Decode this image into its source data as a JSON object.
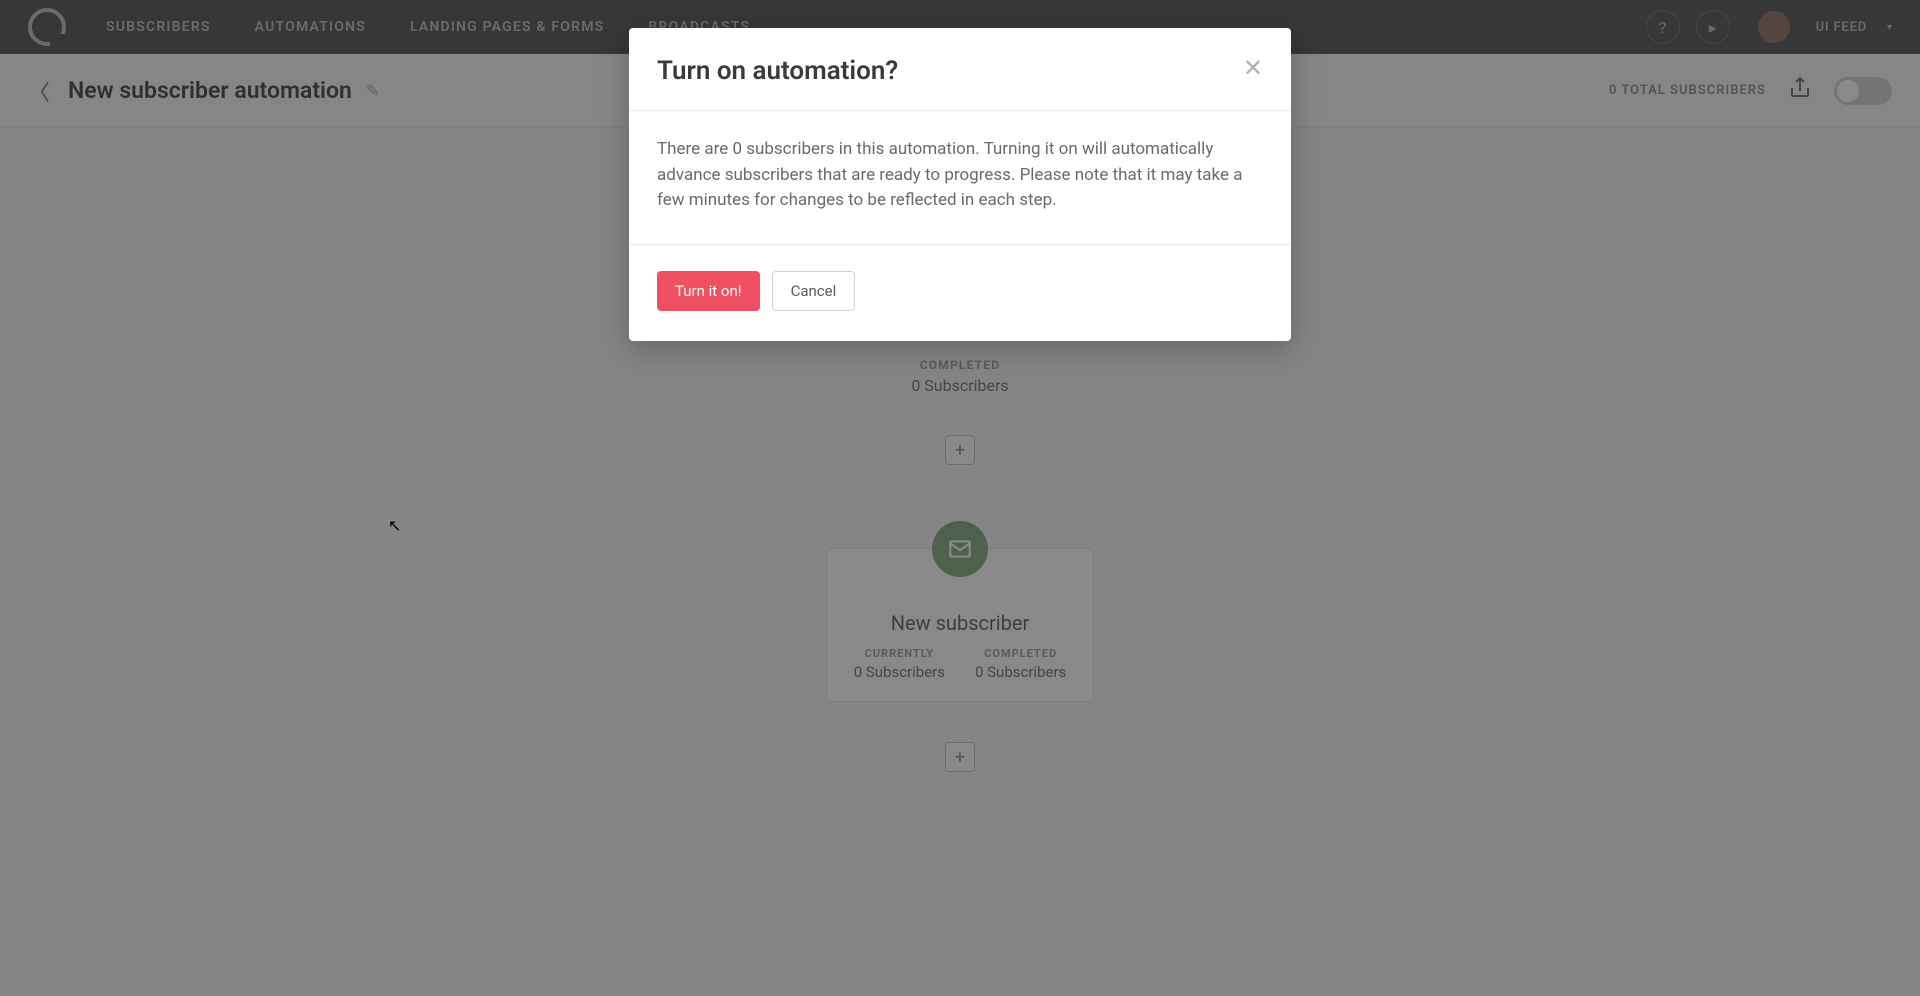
{
  "nav": {
    "subscribers": "SUBSCRIBERS",
    "automations": "AUTOMATIONS",
    "landing": "LANDING PAGES & FORMS",
    "broadcasts": "BROADCASTS",
    "user": "UI FEED"
  },
  "subheader": {
    "title": "New subscriber automation",
    "total": "0 TOTAL SUBSCRIBERS"
  },
  "step1": {
    "label": "COMPLETED",
    "value": "0 Subscribers"
  },
  "step2": {
    "title": "New subscriber",
    "currently_label": "CURRENTLY",
    "currently_value": "0 Subscribers",
    "completed_label": "COMPLETED",
    "completed_value": "0 Subscribers"
  },
  "modal": {
    "title": "Turn on automation?",
    "body": "There are 0 subscribers in this automation. Turning it on will automatically advance subscribers that are ready to progress. Please note that it may take a few minutes for changes to be reflected in each step.",
    "confirm": "Turn it on!",
    "cancel": "Cancel"
  }
}
